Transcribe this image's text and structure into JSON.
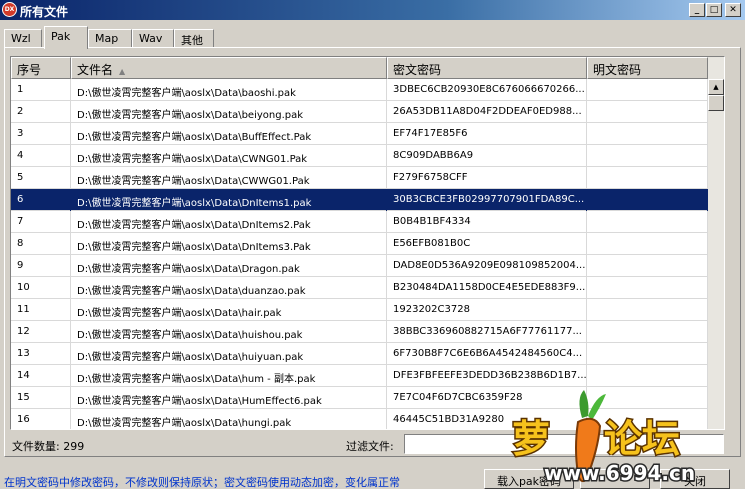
{
  "window": {
    "title": "所有文件",
    "icon_label": "DX",
    "controls": {
      "minimize": "_",
      "maximize": "□",
      "close": "✕"
    }
  },
  "tabs": [
    {
      "label": "Wzl",
      "active": false
    },
    {
      "label": "Pak",
      "active": true
    },
    {
      "label": "Map",
      "active": false
    },
    {
      "label": "Wav",
      "active": false
    },
    {
      "label": "其他",
      "active": false
    }
  ],
  "table": {
    "columns": [
      "序号",
      "文件名",
      "密文密码",
      "明文密码"
    ],
    "sort_indicator": "▲",
    "rows": [
      {
        "no": "1",
        "file": "D:\\傲世凌霄完整客户端\\aoslx\\Data\\baoshi.pak",
        "cipher": "3DBEC6CB20930E8C676066670266...",
        "plain": ""
      },
      {
        "no": "2",
        "file": "D:\\傲世凌霄完整客户端\\aoslx\\Data\\beiyong.pak",
        "cipher": "26A53DB11A8D04F2DDEAF0ED988...",
        "plain": ""
      },
      {
        "no": "3",
        "file": "D:\\傲世凌霄完整客户端\\aoslx\\Data\\BuffEffect.Pak",
        "cipher": "EF74F17E85F6",
        "plain": ""
      },
      {
        "no": "4",
        "file": "D:\\傲世凌霄完整客户端\\aoslx\\Data\\CWNG01.Pak",
        "cipher": "8C909DABB6A9",
        "plain": ""
      },
      {
        "no": "5",
        "file": "D:\\傲世凌霄完整客户端\\aoslx\\Data\\CWWG01.Pak",
        "cipher": "F279F6758CFF",
        "plain": ""
      },
      {
        "no": "6",
        "file": "D:\\傲世凌霄完整客户端\\aoslx\\Data\\DnItems1.pak",
        "cipher": "30B3CBCE3FB02997707901FDA89C...",
        "plain": "",
        "selected": true
      },
      {
        "no": "7",
        "file": "D:\\傲世凌霄完整客户端\\aoslx\\Data\\DnItems2.Pak",
        "cipher": "B0B4B1BF4334",
        "plain": ""
      },
      {
        "no": "8",
        "file": "D:\\傲世凌霄完整客户端\\aoslx\\Data\\DnItems3.Pak",
        "cipher": "E56EFB081B0C",
        "plain": ""
      },
      {
        "no": "9",
        "file": "D:\\傲世凌霄完整客户端\\aoslx\\Data\\Dragon.pak",
        "cipher": "DAD8E0D536A9209E098109852004...",
        "plain": ""
      },
      {
        "no": "10",
        "file": "D:\\傲世凌霄完整客户端\\aoslx\\Data\\duanzao.pak",
        "cipher": "B230484DA1158D0CE4E5EDE883F9...",
        "plain": ""
      },
      {
        "no": "11",
        "file": "D:\\傲世凌霄完整客户端\\aoslx\\Data\\hair.pak",
        "cipher": "1923202C3728",
        "plain": ""
      },
      {
        "no": "12",
        "file": "D:\\傲世凌霄完整客户端\\aoslx\\Data\\huishou.pak",
        "cipher": "38BBC336960882715A6F77761177...",
        "plain": ""
      },
      {
        "no": "13",
        "file": "D:\\傲世凌霄完整客户端\\aoslx\\Data\\huiyuan.pak",
        "cipher": "6F730B8F7C6E6B6A4542484560C4...",
        "plain": ""
      },
      {
        "no": "14",
        "file": "D:\\傲世凌霄完整客户端\\aoslx\\Data\\hum - 副本.pak",
        "cipher": "DFE3FBFEEFE3DEDD36B238B6D1B7...",
        "plain": ""
      },
      {
        "no": "15",
        "file": "D:\\傲世凌霄完整客户端\\aoslx\\Data\\HumEffect6.pak",
        "cipher": "7E7C04F6D7CBC6359F28",
        "plain": ""
      },
      {
        "no": "16",
        "file": "D:\\傲世凌霄完整客户端\\aoslx\\Data\\hungi.pak",
        "cipher": "46445C51BD31A9280",
        "plain": ""
      }
    ]
  },
  "footer": {
    "count_label": "文件数量: 299",
    "filter_label": "过滤文件:",
    "filter_value": "",
    "hint": "在明文密码中修改密码，不修改则保持原状；密文密码使用动态加密，变化属正常",
    "load_button": "载入pak密码",
    "close_button": "关闭"
  },
  "watermark": {
    "brand": "萝卜论坛",
    "url": "www.6994.cn"
  }
}
